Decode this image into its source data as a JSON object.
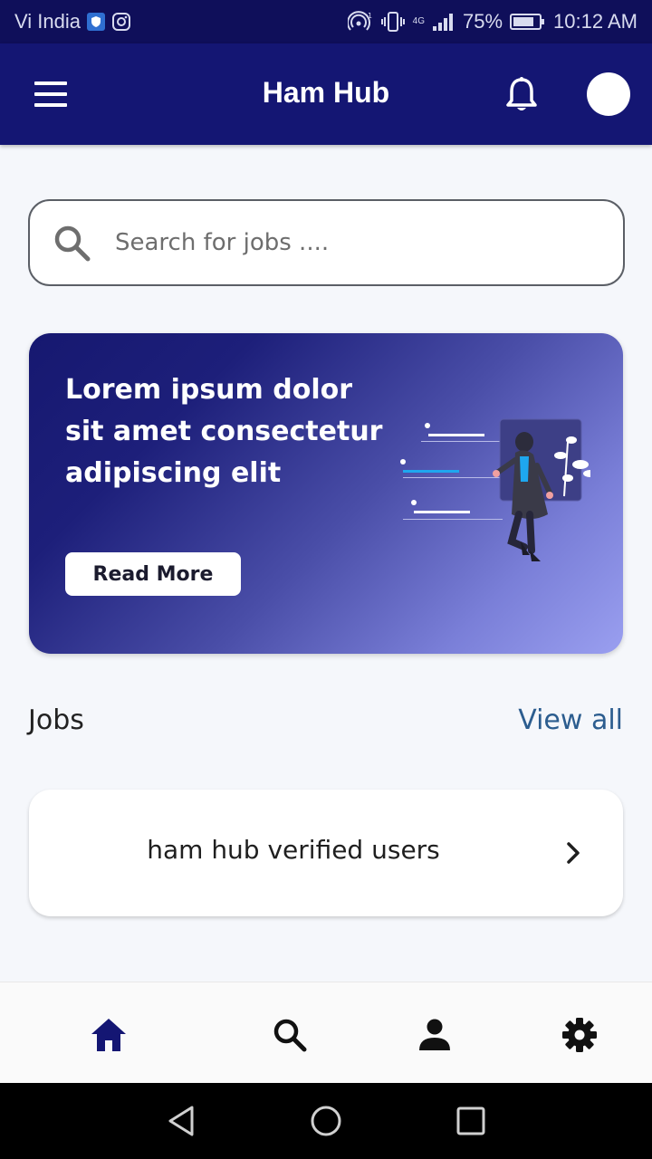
{
  "status_bar": {
    "carrier": "Vi India",
    "network": "4G",
    "battery": "75%",
    "time": "10:12 AM"
  },
  "app_bar": {
    "title": "Ham Hub"
  },
  "search": {
    "placeholder": "Search for jobs ...."
  },
  "banner": {
    "text": "Lorem ipsum dolor sit amet consectetur adipiscing elit",
    "button_label": "Read More"
  },
  "jobs_section": {
    "title": "Jobs",
    "view_all_label": "View all",
    "items": [
      {
        "label": "ham hub verified users"
      }
    ]
  },
  "bottom_nav": {
    "items": [
      {
        "icon": "home-icon",
        "active": true
      },
      {
        "icon": "search-icon",
        "active": false
      },
      {
        "icon": "person-icon",
        "active": false
      },
      {
        "icon": "gear-icon",
        "active": false
      }
    ]
  },
  "colors": {
    "primary": "#141673",
    "status_bar": "#0f0f5a",
    "link": "#2c5d8f",
    "background": "#f5f7fb"
  }
}
